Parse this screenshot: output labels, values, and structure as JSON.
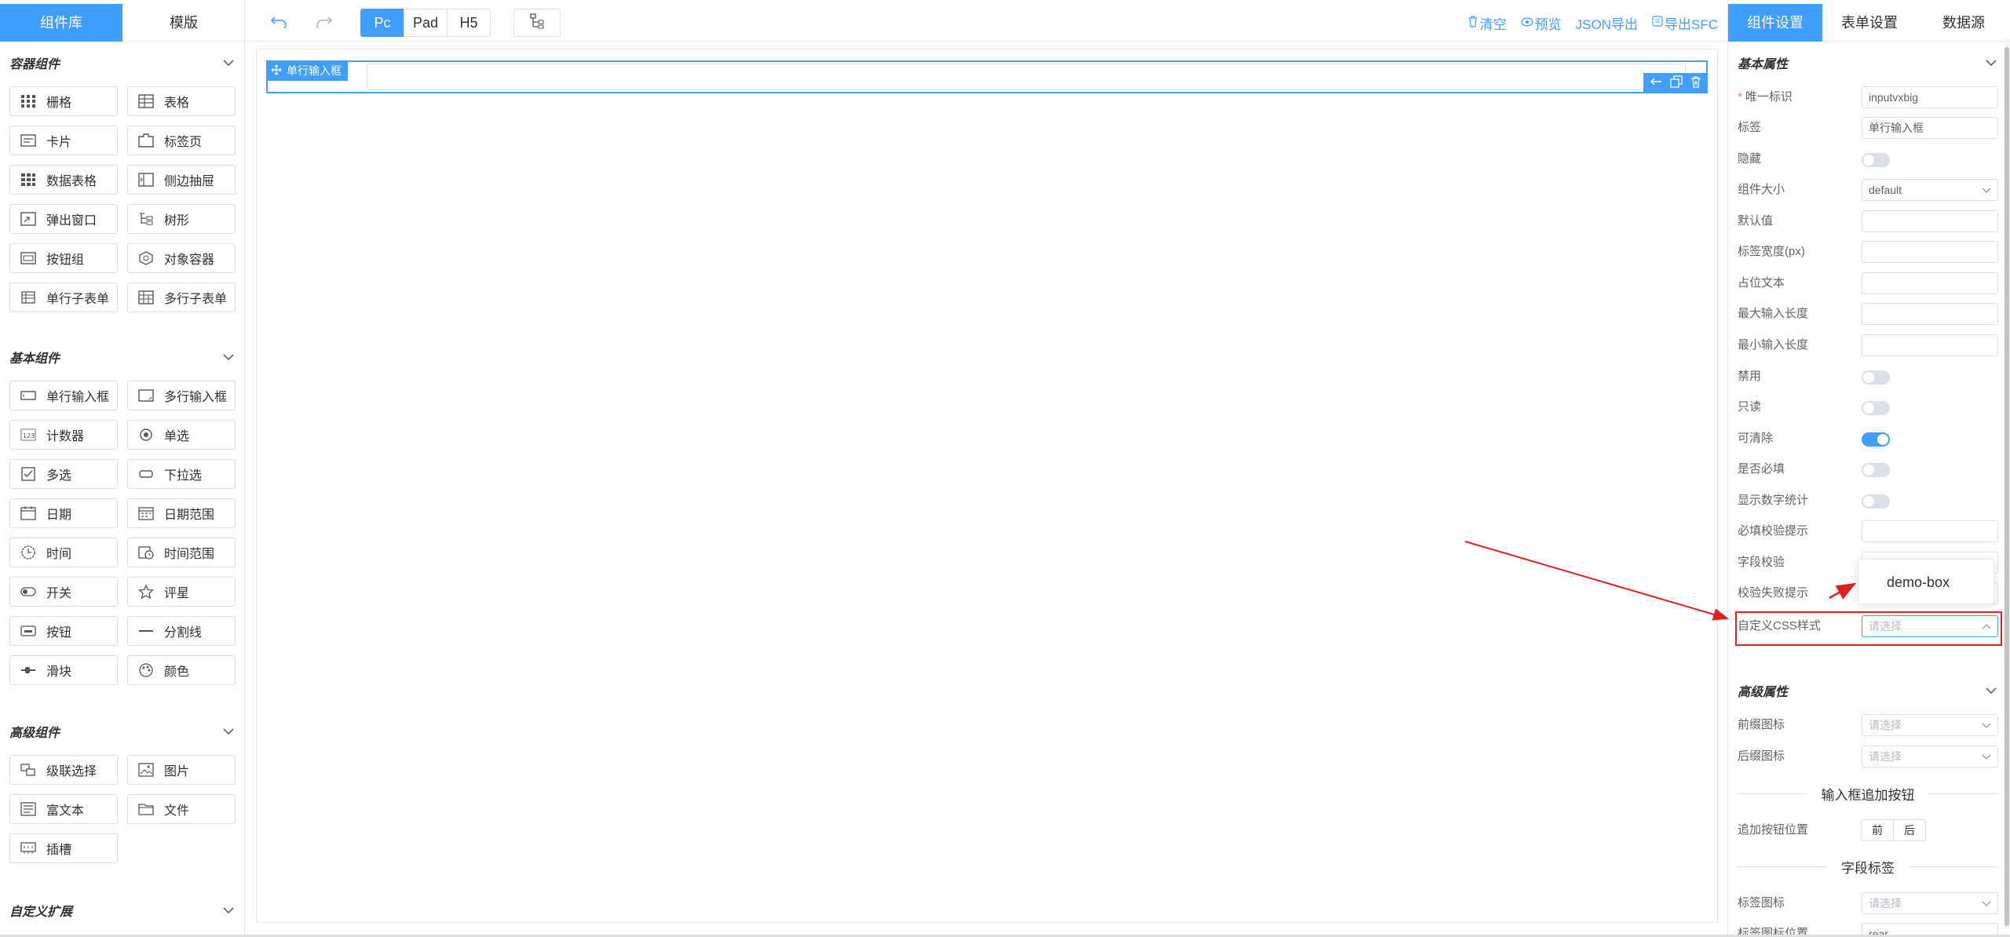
{
  "left": {
    "tabs": [
      {
        "label": "组件库"
      },
      {
        "label": "模版"
      }
    ],
    "sections": [
      {
        "title": "容器组件",
        "items": [
          {
            "label": "栅格",
            "icon": "grid-icon"
          },
          {
            "label": "表格",
            "icon": "table-icon"
          },
          {
            "label": "卡片",
            "icon": "card-icon"
          },
          {
            "label": "标签页",
            "icon": "tabs-icon"
          },
          {
            "label": "数据表格",
            "icon": "data-table-icon"
          },
          {
            "label": "侧边抽屉",
            "icon": "drawer-icon"
          },
          {
            "label": "弹出窗口",
            "icon": "dialog-icon"
          },
          {
            "label": "树形",
            "icon": "tree-icon"
          },
          {
            "label": "按钮组",
            "icon": "button-group-icon"
          },
          {
            "label": "对象容器",
            "icon": "object-container-icon"
          },
          {
            "label": "单行子表单",
            "icon": "sub-form-icon"
          },
          {
            "label": "多行子表单",
            "icon": "grid-sub-form-icon"
          }
        ]
      },
      {
        "title": "基本组件",
        "items": [
          {
            "label": "单行输入框",
            "icon": "input-icon"
          },
          {
            "label": "多行输入框",
            "icon": "textarea-icon"
          },
          {
            "label": "计数器",
            "icon": "number-icon"
          },
          {
            "label": "单选",
            "icon": "radio-icon"
          },
          {
            "label": "多选",
            "icon": "checkbox-icon"
          },
          {
            "label": "下拉选",
            "icon": "select-icon"
          },
          {
            "label": "日期",
            "icon": "date-icon"
          },
          {
            "label": "日期范围",
            "icon": "date-range-icon"
          },
          {
            "label": "时间",
            "icon": "time-icon"
          },
          {
            "label": "时间范围",
            "icon": "time-range-icon"
          },
          {
            "label": "开关",
            "icon": "switch-icon"
          },
          {
            "label": "评星",
            "icon": "rate-icon"
          },
          {
            "label": "按钮",
            "icon": "button-icon"
          },
          {
            "label": "分割线",
            "icon": "divider-icon"
          },
          {
            "label": "滑块",
            "icon": "slider-icon"
          },
          {
            "label": "颜色",
            "icon": "color-icon"
          }
        ]
      },
      {
        "title": "高级组件",
        "items": [
          {
            "label": "级联选择",
            "icon": "cascader-icon"
          },
          {
            "label": "图片",
            "icon": "picture-icon"
          },
          {
            "label": "富文本",
            "icon": "rich-text-icon"
          },
          {
            "label": "文件",
            "icon": "file-icon"
          },
          {
            "label": "插槽",
            "icon": "slot-icon"
          }
        ]
      },
      {
        "title": "自定义扩展",
        "items": []
      }
    ]
  },
  "toolbar": {
    "devices": [
      {
        "label": "Pc"
      },
      {
        "label": "Pad"
      },
      {
        "label": "H5"
      }
    ],
    "active_device": "Pc",
    "links": [
      {
        "label": "清空",
        "icon": "trash-icon"
      },
      {
        "label": "预览",
        "icon": "eye-icon"
      },
      {
        "label": "JSON导出",
        "icon": ""
      },
      {
        "label": "导出SFC",
        "icon": "export-icon"
      }
    ]
  },
  "canvas": {
    "field_tag": "单行输入框"
  },
  "right": {
    "tabs": [
      {
        "label": "组件设置"
      },
      {
        "label": "表单设置"
      },
      {
        "label": "数据源"
      }
    ],
    "basic_title": "基本属性",
    "advanced_title": "高级属性",
    "props": {
      "unique_id": {
        "label": "唯一标识",
        "value": "inputvxbig"
      },
      "label": {
        "label": "标签",
        "value": "单行输入框"
      },
      "hidden": {
        "label": "隐藏"
      },
      "size": {
        "label": "组件大小",
        "value": "default"
      },
      "default_value": {
        "label": "默认值"
      },
      "label_width": {
        "label": "标签宽度(px)"
      },
      "placeholder": {
        "label": "占位文本"
      },
      "max_length": {
        "label": "最大输入长度"
      },
      "min_length": {
        "label": "最小输入长度"
      },
      "disabled": {
        "label": "禁用"
      },
      "readonly": {
        "label": "只读"
      },
      "clearable": {
        "label": "可清除"
      },
      "required": {
        "label": "是否必填"
      },
      "show_word_limit": {
        "label": "显示数字统计"
      },
      "required_hint": {
        "label": "必填校验提示"
      },
      "validation": {
        "label": "字段校验"
      },
      "validation_hint": {
        "label": "校验失败提示"
      },
      "custom_css": {
        "label": "自定义CSS样式",
        "placeholder": "请选择"
      }
    },
    "advanced": {
      "prefix_icon": {
        "label": "前缀图标",
        "placeholder": "请选择"
      },
      "suffix_icon": {
        "label": "后缀图标",
        "placeholder": "请选择"
      },
      "append_divider": "输入框追加按钮",
      "append_position": {
        "label": "追加按钮位置",
        "options": [
          "前",
          "后"
        ]
      },
      "field_label_divider": "字段标签",
      "label_icon": {
        "label": "标签图标",
        "placeholder": "请选择"
      },
      "label_icon_position": {
        "label": "标签图标位置",
        "value": "rear"
      }
    },
    "css_popup": {
      "option": "demo-box"
    }
  },
  "colors": {
    "accent": "#409eff",
    "annotation": "#e02020"
  }
}
